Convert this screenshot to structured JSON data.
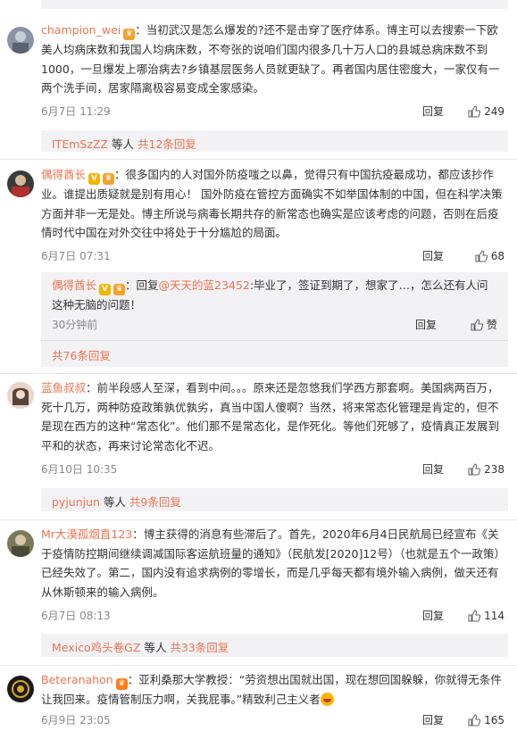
{
  "comments": [
    {
      "username": "champion_wei",
      "text": "当初武汉是怎么爆发的?还不是击穿了医疗体系。博主可以去搜索一下欧美人均病床数和我国人均病床数，不夸张的说咱们国内很多几十万人口的县城总病床数不到1000，一旦爆发上哪治病去?乡镇基层医务人员就更缺了。再者国内居住密度大，一家仅有一两个洗手间，居家隔离极容易变成全家感染。",
      "time": "6月7日 11:29",
      "reply": "回复",
      "likes": "249",
      "sub": {
        "name": "ITEmSzZZ",
        "mid": " 等人 ",
        "count": "共12条回复"
      }
    },
    {
      "username": "偶得酋长",
      "text": "很多国内的人对国外防疫嗤之以鼻，觉得只有中国抗疫最成功，都应该抄作业。谁提出质疑就是别有用心！ 国外防疫在管控方面确实不如举国体制的中国，但在科学决策方面并非一无是处。博主所说与病毒长期共存的新常态也确实是应该考虑的问题，否则在后疫情时代中国在对外交往中将处于十分尴尬的局面。",
      "time": "6月7日 07:31",
      "reply": "回复",
      "likes": "68",
      "nested": {
        "username": "偶得酋长",
        "reply_prefix": "回复",
        "mention": "@天天的蓝23452",
        "text": ":毕业了，签证到期了，想家了…，怎么还有人问这种无脑的问题！",
        "time": "30分钟前",
        "reply": "回复",
        "likes": "赞"
      },
      "sub_total": "共76条回复"
    },
    {
      "username": "蓝鱼叔叔",
      "text": "前半段感人至深，看到中间。。。原来还是忽悠我们学西方那套啊。美国病两百万，死十几万，两种防疫政策孰优孰劣，真当中国人傻啊？当然，将来常态化管理是肯定的，但不是现在西方的这种“常态化”。他们那不是常态化，是作死化。等他们死够了，疫情真正发展到平和的状态，再来讨论常态化不迟。",
      "time": "6月10日 10:35",
      "reply": "回复",
      "likes": "238",
      "sub": {
        "name": "pyjunjun",
        "mid": " 等人 ",
        "count": "共9条回复"
      }
    },
    {
      "username": "Mr大漠孤烟直123",
      "text": "博主获得的消息有些滞后了。首先，2020年6月4日民航局已经宣布《关于疫情防控期间继续调减国际客运航班量的通知》（民航发[2020]12号）（也就是五个一政策）已经失效了。第二，国内没有追求病例的零增长，而是几乎每天都有境外输入病例，做天还有从休斯顿来的输入病例。",
      "time": "6月7日 08:13",
      "reply": "回复",
      "likes": "114",
      "sub": {
        "name": "Mexico鸡头卷GZ",
        "mid": " 等人 ",
        "count": "共33条回复"
      }
    },
    {
      "username": "Beteranahon",
      "text": "亚利桑那大学教授：“劳资想出国就出国，现在想回国躲躲，你就得无条件让我回来。疫情管制压力啊，关我屁事。”精致利己主义者",
      "time": "6月9日 23:05",
      "reply": "回复",
      "likes": "165"
    }
  ],
  "colors": {
    "accent": "#eb7350",
    "subbox_bg": "#f2f2f5",
    "meta_gray": "#8a8a8a"
  },
  "icons": [
    "thumb-up-icon",
    "vip-badge-icon",
    "verified-badge-icon",
    "smiley-icon"
  ]
}
